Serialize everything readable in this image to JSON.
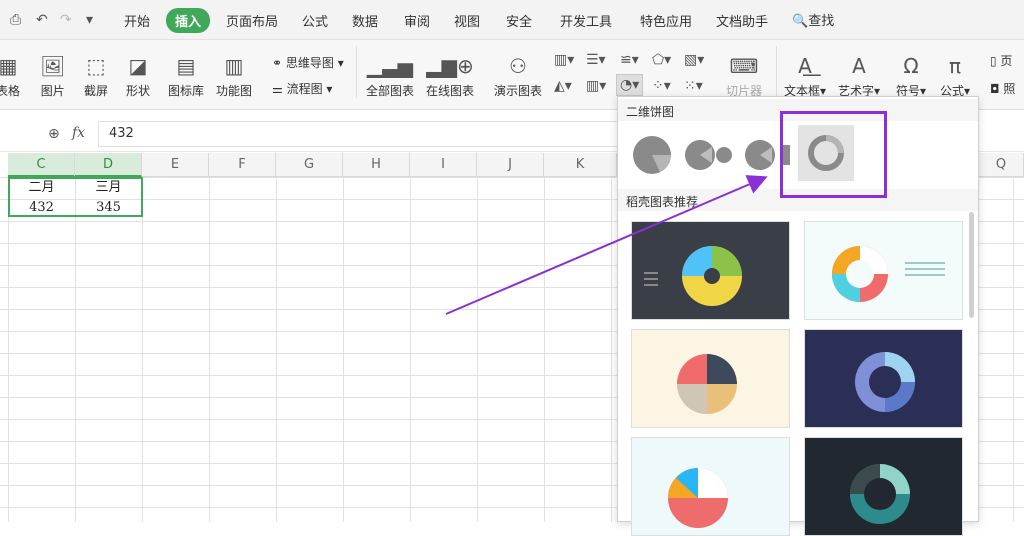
{
  "menu": {
    "tabs": [
      "开始",
      "插入",
      "页面布局",
      "公式",
      "数据",
      "审阅",
      "视图",
      "安全",
      "开发工具",
      "特色应用",
      "文档助手"
    ],
    "active_tab": "插入",
    "search": "查找"
  },
  "ribbon": {
    "table_label": "表格",
    "picture": "图片",
    "screenshot": "截屏",
    "shape": "形状",
    "iconlib": "图标库",
    "funcchart": "功能图",
    "mindmap": "思维导图",
    "flowchart": "流程图",
    "allcharts": "全部图表",
    "onlinechart": "在线图表",
    "demochart": "演示图表",
    "slicer": "切片器",
    "textbox": "文本框",
    "arttext": "艺术字",
    "symbol": "符号",
    "formula": "公式",
    "page_hdr": "页",
    "photo": "照"
  },
  "formula_bar": {
    "fx": "fx",
    "value": "432"
  },
  "columns": [
    "C",
    "D",
    "E",
    "F",
    "G",
    "H",
    "I",
    "J",
    "K",
    "Q"
  ],
  "cells": {
    "c1": "二月",
    "d1": "三月",
    "c2": "432",
    "d2": "345"
  },
  "panel": {
    "section1": "二维饼图",
    "section2": "稻壳图表推荐",
    "highlight_color": "#8b2fd6"
  }
}
